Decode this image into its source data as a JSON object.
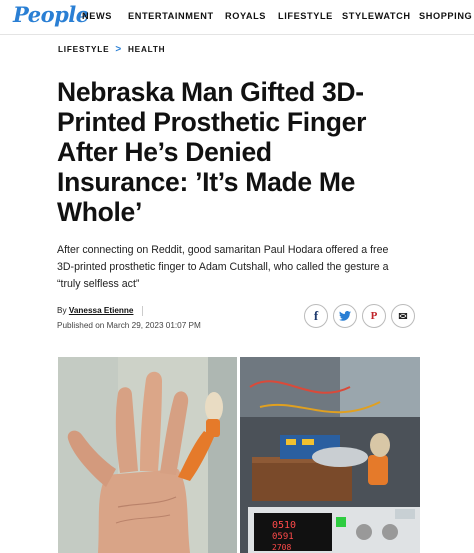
{
  "header": {
    "logo": "People",
    "nav": [
      "NEWS",
      "ENTERTAINMENT",
      "ROYALS",
      "LIFESTYLE",
      "STYLEWATCH",
      "SHOPPING"
    ]
  },
  "breadcrumb": {
    "items": [
      "LIFESTYLE",
      "HEALTH"
    ],
    "separator": ">"
  },
  "article": {
    "headline_lines": [
      "Nebraska Man Gifted 3D-",
      "Printed Prosthetic Finger",
      "After He’s Denied",
      "Insurance: ’It’s Made Me",
      "Whole’"
    ],
    "dek_lines": [
      "After connecting on Reddit, good samaritan Paul Hodara offered a free",
      "3D-printed prosthetic finger to Adam Cutshall, who called the gesture a",
      "“truly selfless act”"
    ],
    "byline_prefix": "By",
    "author": "Vanessa Etienne",
    "published": "Published on March 29, 2023 01:07 PM"
  },
  "share": [
    {
      "name": "facebook",
      "glyph": "f"
    },
    {
      "name": "twitter",
      "glyph": "🐦"
    },
    {
      "name": "pinterest",
      "glyph": "P"
    },
    {
      "name": "email",
      "glyph": "✉"
    }
  ],
  "images": {
    "right_display": [
      "0510",
      "0591",
      "2708"
    ]
  },
  "colors": {
    "brand": "#2a7fd4",
    "accent_orange": "#e57a2a"
  }
}
